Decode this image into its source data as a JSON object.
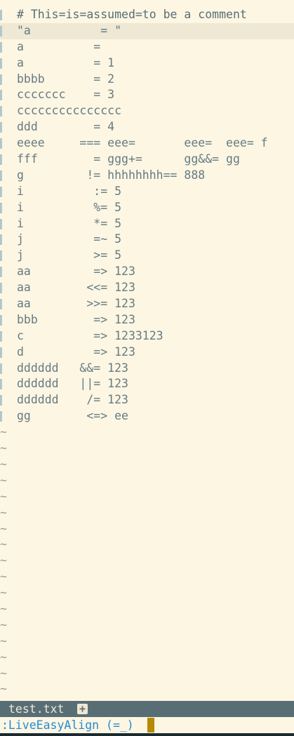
{
  "editor": {
    "lines": [
      "# This=is=assumed=to be a comment",
      "\"a          = \"",
      "a          =",
      "a          = 1",
      "bbbb       = 2",
      "ccccccc    = 3",
      "ccccccccccccccc",
      "ddd        = 4",
      "eeee     === eee=       eee=  eee= f",
      "fff        = ggg+=      gg&&= gg",
      "g         != hhhhhhhh== 888",
      "i          := 5",
      "i          %= 5",
      "i          *= 5",
      "j          =~ 5",
      "j          >= 5",
      "aa         => 123",
      "aa        <<= 123",
      "aa        >>= 123",
      "bbb        => 123",
      "c          => 1233123",
      "d          => 123",
      "dddddd   &&= 123",
      "dddddd   ||= 123",
      "dddddd    /= 123",
      "gg        <=> ee"
    ],
    "tilde": "~",
    "tilde_count": 17
  },
  "statusline": {
    "filename": "test.txt",
    "modified_marker": "+"
  },
  "cmdline": {
    "text": ":LiveEasyAlign (=_)"
  },
  "colors": {
    "background": "#fdf6e3",
    "cursorline": "#eee8d5",
    "text": "#657b83",
    "statusline_bg": "#586e75",
    "cmd_text": "#268bd2",
    "cursor": "#b58900"
  }
}
